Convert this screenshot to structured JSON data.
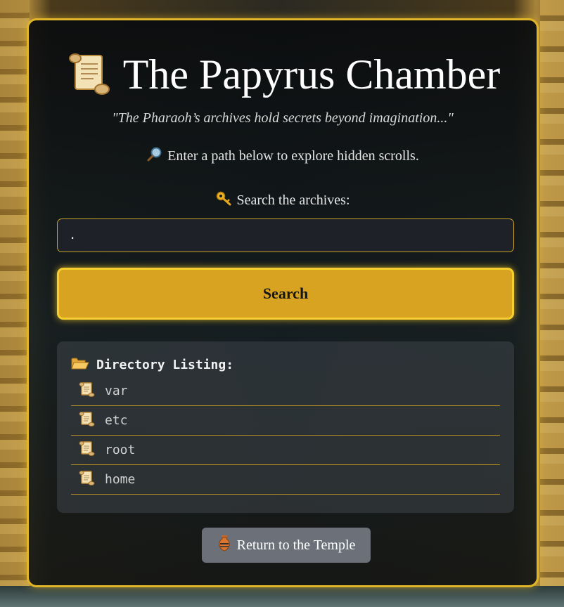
{
  "page": {
    "title": "The Papyrus Chamber",
    "quote": "\"The Pharaoh’s archives hold secrets beyond imagination...\"",
    "hint": "Enter a path below to explore hidden scrolls.",
    "search_label": "Search the archives:",
    "search_value": ".",
    "search_button": "Search",
    "listing_title": "Directory Listing:",
    "entries": [
      "var",
      "etc",
      "root",
      "home"
    ],
    "return_button": "Return to the Temple"
  },
  "icons": {
    "title_icon": "scroll-icon",
    "hint_icon": "magnifier-icon",
    "search_label_icon": "key-icon",
    "listing_icon": "open-folder-icon",
    "entry_icon": "scroll-icon",
    "return_icon": "amphora-icon"
  },
  "colors": {
    "accent": "#e0b52a",
    "button": "#d9a322",
    "panel": "#0f1417",
    "return_button": "#6b7079"
  }
}
